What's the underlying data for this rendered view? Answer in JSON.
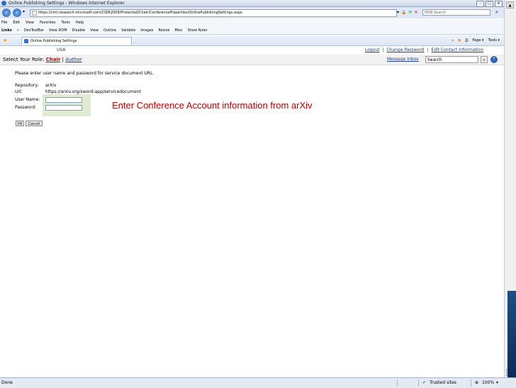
{
  "window": {
    "title": "Online Publishing Settings - Windows Internet Explorer"
  },
  "browser": {
    "address": "https://cmt.research.microsoft.com/CIDR2009/Protected/Chair/ConferenceProperties/OnlinePublishingSettings.aspx",
    "search_placeholder": "MSN Search",
    "menu": [
      "File",
      "Edit",
      "View",
      "Favorites",
      "Tools",
      "Help"
    ],
    "links_label": "Links",
    "links": [
      "DevToolBar",
      "View DOM",
      "Disable",
      "View",
      "Outline",
      "Validate",
      "Images",
      "Resize",
      "Misc",
      "Show Ruler"
    ],
    "tab_title": "Online Publishing Settings",
    "command_bar": {
      "page": "Page",
      "tools": "Tools"
    },
    "status": {
      "left": "Done",
      "zone": "Trusted sites",
      "zoom": "100%"
    }
  },
  "page": {
    "location": "USA",
    "top_links": {
      "logout": "Logout",
      "change_password": "Change Password",
      "edit_contact": "Edit Contact Information",
      "sep": "|"
    },
    "role": {
      "label": "Select Your Role:",
      "chair": "Chair",
      "sep": "|",
      "author": "Author"
    },
    "message_inbox": "Message Inbox",
    "search_value": "Search",
    "instructions": "Please enter user name and password for service document URL.",
    "form": {
      "repository_label": "Repository:",
      "repository_value": "arXiv",
      "url_label": "Url:",
      "url_value": "https://arxiv.org/sword-app/servicedocument",
      "username_label": "User Name:",
      "password_label": "Password:",
      "ok": "OK",
      "cancel": "Cancel"
    },
    "annotation": "Enter Conference Account information from arXiv"
  }
}
